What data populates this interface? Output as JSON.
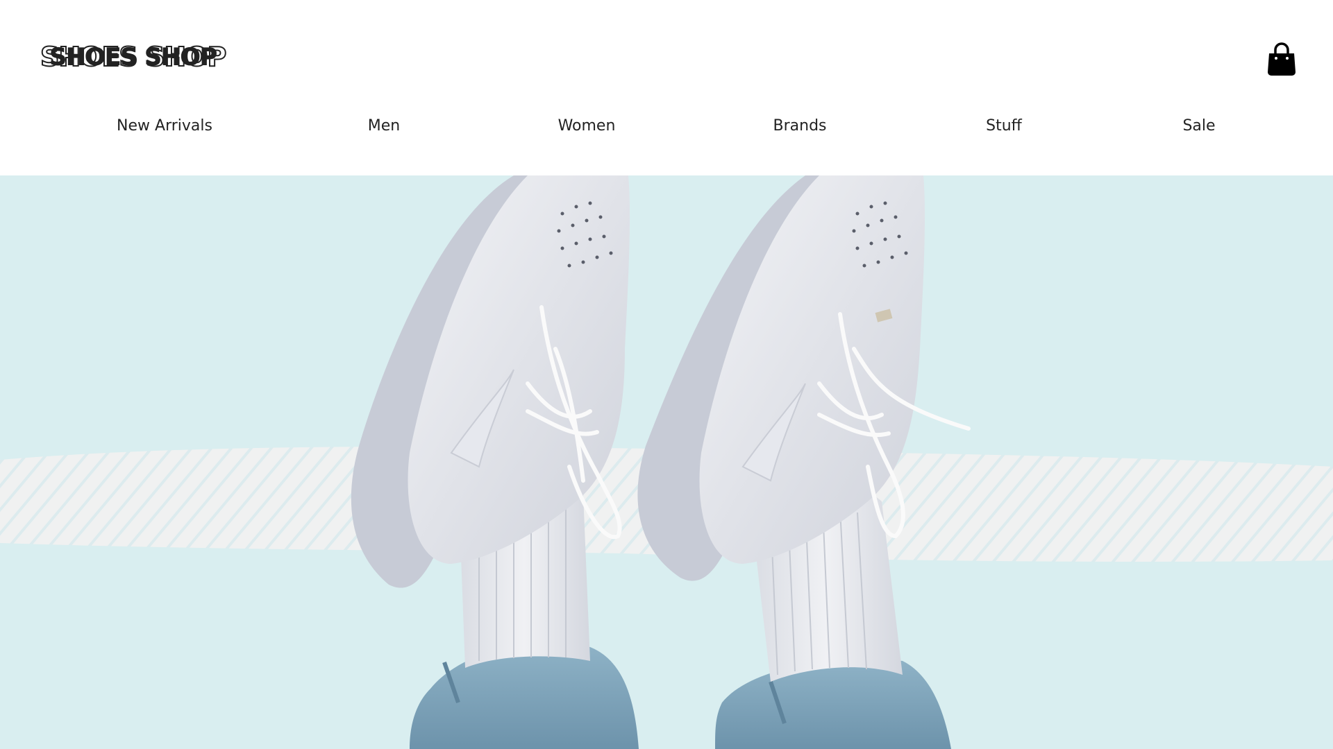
{
  "brand": {
    "logo_text": "SHOES SHOP"
  },
  "header": {
    "cart_icon": "shopping-bag-icon"
  },
  "nav": {
    "items": [
      {
        "label": "New Arrivals"
      },
      {
        "label": "Men"
      },
      {
        "label": "Women"
      },
      {
        "label": "Brands"
      },
      {
        "label": "Stuff"
      },
      {
        "label": "Sale"
      }
    ]
  },
  "hero": {
    "image": "white-sneakers-on-feet-photo",
    "background_color": "#d9eef0",
    "stripe_color": "#eeeeee",
    "sneaker_color": "#e8e9ee",
    "jeans_color": "#7fa6bd"
  }
}
